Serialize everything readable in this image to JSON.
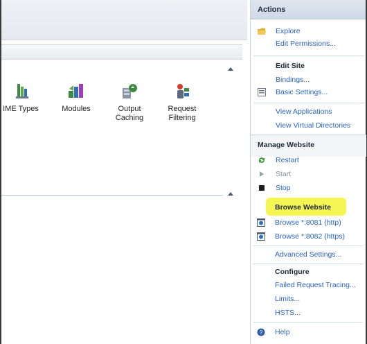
{
  "features": [
    {
      "id": "mime",
      "label": "IME Types",
      "icon": "mime-types-icon"
    },
    {
      "id": "modules",
      "label": "Modules",
      "icon": "modules-icon"
    },
    {
      "id": "output",
      "label": "Output\nCaching",
      "icon": "output-caching-icon"
    },
    {
      "id": "request",
      "label": "Request\nFiltering",
      "icon": "request-filtering-icon"
    }
  ],
  "actions": {
    "header": "Actions",
    "explore": "Explore",
    "edit_permissions": "Edit Permissions...",
    "edit_site": {
      "title": "Edit Site",
      "bindings": "Bindings...",
      "basic_settings": "Basic Settings...",
      "view_applications": "View Applications",
      "view_virtual_directories": "View Virtual Directories"
    },
    "manage_website": {
      "title": "Manage Website",
      "restart": "Restart",
      "start": "Start",
      "stop": "Stop",
      "browse_website": "Browse Website",
      "browse_http": "Browse *:8081 (http)",
      "browse_https": "Browse *:8082 (https)",
      "advanced_settings": "Advanced Settings..."
    },
    "configure": {
      "title": "Configure",
      "failed_request_tracing": "Failed Request Tracing...",
      "limits": "Limits...",
      "hsts": "HSTS..."
    },
    "help": "Help"
  },
  "colors": {
    "link": "#2a62c2",
    "highlight": "#f4f64a",
    "header_bg": "#cfd9e6"
  }
}
